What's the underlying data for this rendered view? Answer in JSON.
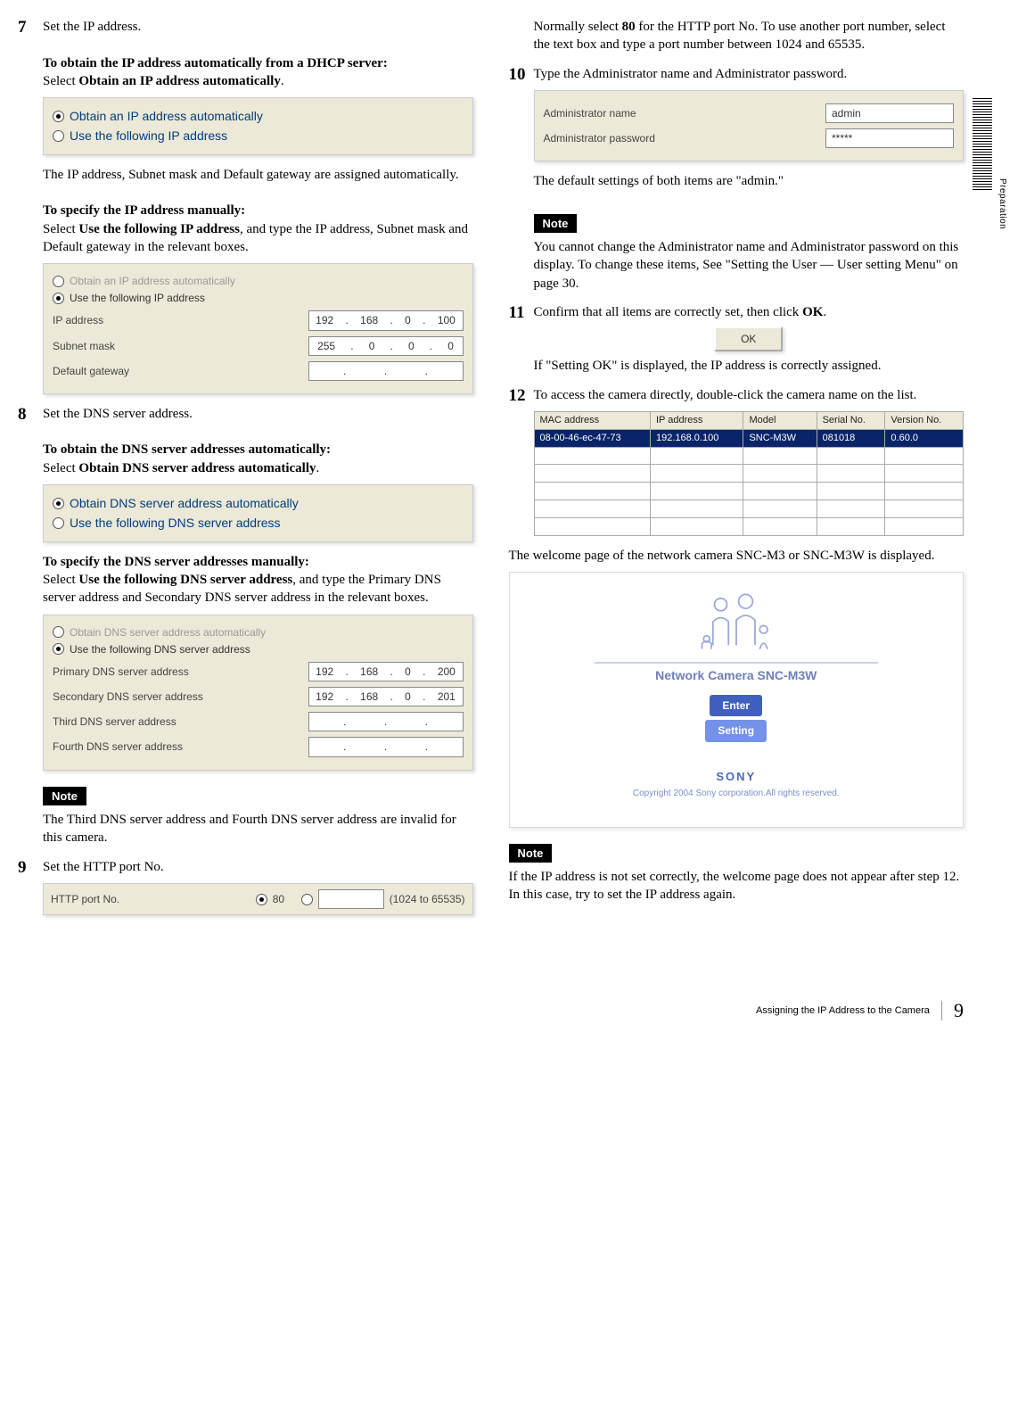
{
  "side_label": "Preparation",
  "left": {
    "s7": {
      "num": "7",
      "text1": "Set the IP address.",
      "heading_dhcp": "To obtain the IP address automatically from a DHCP server:",
      "select_dhcp_prefix": "Select ",
      "select_dhcp_bold": "Obtain an IP address automatically",
      "select_dhcp_suffix": ".",
      "fig1_opt1": "Obtain an IP address automatically",
      "fig1_opt2": "Use the following IP address",
      "after_fig1": "The IP address, Subnet mask and Default gateway are assigned automatically.",
      "heading_manual": "To specify the IP address manually:",
      "manual_prefix": "Select ",
      "manual_bold": "Use the following IP address",
      "manual_suffix": ", and type the IP address, Subnet mask and Default gateway in the relevant boxes.",
      "fig2_opt1": "Obtain an IP address automatically",
      "fig2_opt2": "Use the following IP address",
      "fig2_labels": {
        "ip": "IP address",
        "mask": "Subnet mask",
        "gw": "Default gateway"
      },
      "fig2_values": {
        "ip": [
          "192",
          "168",
          "0",
          "100"
        ],
        "mask": [
          "255",
          "0",
          "0",
          "0"
        ],
        "gw": [
          ".",
          ".",
          "."
        ]
      }
    },
    "s8": {
      "num": "8",
      "text1": "Set the DNS server address.",
      "heading_auto": "To obtain the DNS server addresses automatically:",
      "auto_prefix": "Select ",
      "auto_bold": "Obtain DNS server address automatically",
      "auto_suffix": ".",
      "fig_opt1": "Obtain DNS server address automatically",
      "fig_opt2": "Use the following DNS server address",
      "heading_manual": "To specify the DNS server addresses manually:",
      "manual_prefix": "Select ",
      "manual_bold": "Use the following DNS server address",
      "manual_suffix": ", and type the Primary DNS server address and Secondary DNS server address in the relevant boxes.",
      "fig2_opt1": "Obtain DNS server address automatically",
      "fig2_opt2": "Use the following DNS server address",
      "fig2_labels": {
        "p": "Primary DNS server address",
        "s": "Secondary DNS server address",
        "t": "Third DNS server address",
        "f": "Fourth DNS server address"
      },
      "fig2_values": {
        "p": [
          "192",
          "168",
          "0",
          "200"
        ],
        "s": [
          "192",
          "168",
          "0",
          "201"
        ],
        "t": [
          ".",
          ".",
          "."
        ],
        "f": [
          ".",
          ".",
          "."
        ]
      },
      "note_label": "Note",
      "note_text": "The Third DNS server address and Fourth DNS server address are invalid for this camera."
    },
    "s9": {
      "num": "9",
      "text1": "Set the HTTP port No.",
      "fig_label": "HTTP port No.",
      "fig_opt80": "80",
      "fig_range": "(1024 to 65535)"
    }
  },
  "right": {
    "s9_cont_prefix": "Normally select ",
    "s9_cont_bold": "80",
    "s9_cont_suffix": " for the HTTP port No.  To use another port number, select the text box and type a port number between 1024 and 65535.",
    "s10": {
      "num": "10",
      "text1": "Type the Administrator name and Administrator password.",
      "fig_name_label": "Administrator name",
      "fig_pass_label": "Administrator password",
      "fig_name_val": "admin",
      "fig_pass_val": "*****",
      "after_fig": "The default settings of both items are \"admin.\"",
      "note_label": "Note",
      "note_text": "You cannot change the Administrator name and Administrator password on this display.  To change these items, See \"Setting the User — User setting Menu\" on page 30."
    },
    "s11": {
      "num": "11",
      "text1_prefix": "Confirm that all items are correctly set, then click ",
      "text1_bold": "OK",
      "text1_suffix": ".",
      "ok_label": "OK",
      "after": "If \"Setting OK\" is displayed, the IP address is correctly assigned."
    },
    "s12": {
      "num": "12",
      "text1": "To access the camera directly, double-click the camera name on the list.",
      "table_headers": [
        "MAC address",
        "IP address",
        "Model",
        "Serial No.",
        "Version No."
      ],
      "table_row": [
        "08-00-46-ec-47-73",
        "192.168.0.100",
        "SNC-M3W",
        "081018",
        "0.60.0"
      ]
    },
    "welcome_para": "The welcome page of the network camera SNC-M3 or SNC-M3W is displayed.",
    "welcome": {
      "title": "Network Camera SNC-M3W",
      "enter": "Enter",
      "setting": "Setting",
      "sony": "SONY",
      "copy": "Copyright 2004 Sony corporation.All rights reserved."
    },
    "note2_label": "Note",
    "note2_text": "If the IP address is not set correctly, the welcome page does not appear after step 12. In this case, try to set the IP address again."
  },
  "footer": {
    "title": "Assigning the IP Address to the Camera",
    "page": "9"
  }
}
